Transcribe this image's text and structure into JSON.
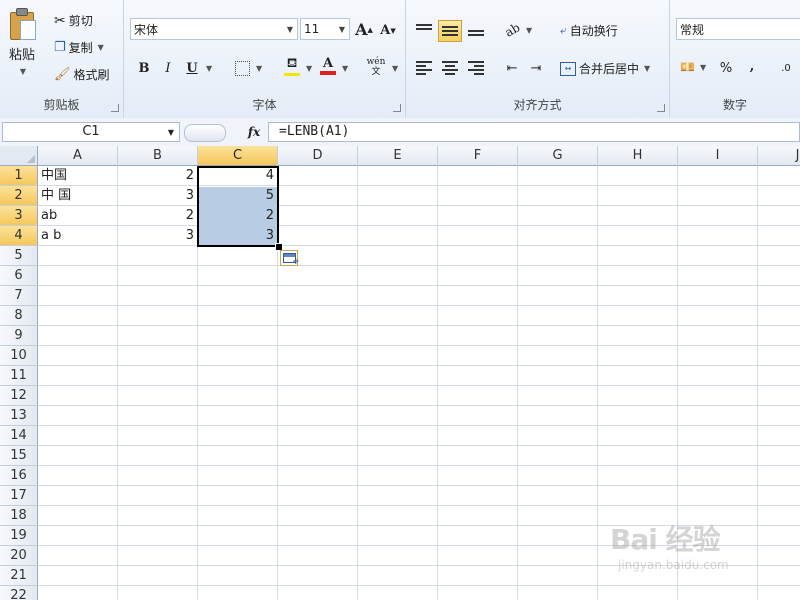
{
  "ribbon": {
    "clipboard": {
      "paste": "粘贴",
      "cut": "剪切",
      "copy": "复制",
      "format_painter": "格式刷",
      "label": "剪贴板"
    },
    "font": {
      "name": "宋体",
      "size": "11",
      "grow": "A",
      "shrink": "A",
      "bold": "B",
      "italic": "I",
      "underline": "U",
      "font_color_letter": "A",
      "phonetic": "wén\n文",
      "label": "字体",
      "fill_color": "#f5e400",
      "font_color": "#e02020"
    },
    "alignment": {
      "wrap_text": "自动换行",
      "merge_center": "合并后居中",
      "label": "对齐方式"
    },
    "number": {
      "format": "常规",
      "percent": "%",
      "comma": ",",
      "decimals": ".0",
      "label": "数字"
    }
  },
  "formula_bar": {
    "name_box": "C1",
    "fx": "fx",
    "formula": "=LENB(A1)"
  },
  "sheet": {
    "columns": [
      "A",
      "B",
      "C",
      "D",
      "E",
      "F",
      "G",
      "H",
      "I",
      "J"
    ],
    "rows": [
      "1",
      "2",
      "3",
      "4",
      "5",
      "6",
      "7",
      "8",
      "9",
      "10",
      "11",
      "12",
      "13",
      "14",
      "15",
      "16",
      "17",
      "18",
      "19",
      "20",
      "21",
      "22"
    ],
    "selected_column": "C",
    "selected_rows": [
      "1",
      "2",
      "3",
      "4"
    ],
    "data": [
      {
        "a": "中国",
        "b": "2",
        "c": "4"
      },
      {
        "a": "中 国",
        "b": "3",
        "c": "5"
      },
      {
        "a": "ab",
        "b": "2",
        "c": "2"
      },
      {
        "a": "a b",
        "b": "3",
        "c": "3"
      }
    ],
    "selection_color": "#b8cce4"
  },
  "watermark": {
    "brand": "Bai 经验",
    "url": "jingyan.baidu.com"
  }
}
